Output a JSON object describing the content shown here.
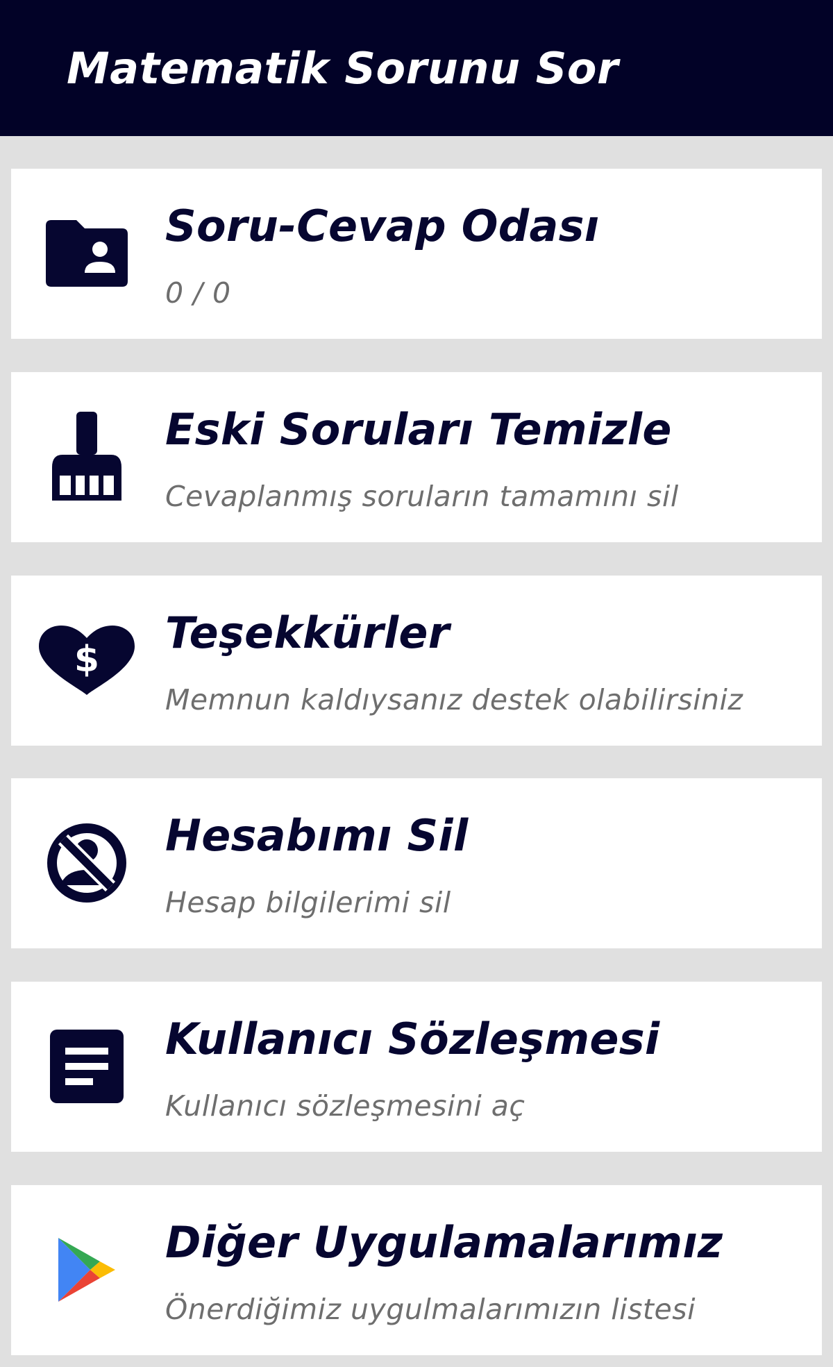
{
  "app_bar": {
    "title": "Matematik Sorunu Sor",
    "background": "#020227"
  },
  "menu": {
    "items": [
      {
        "title": "Soru-Cevap Odası",
        "subtitle": "0 / 0",
        "icon": "folder-shared-icon"
      },
      {
        "title": "Eski Soruları Temizle",
        "subtitle": "Cevaplanmış soruların tamamını sil",
        "icon": "cleaning-brush-icon"
      },
      {
        "title": "Teşekkürler",
        "subtitle": "Memnun kaldıysanız destek olabilirsiniz",
        "icon": "heart-dollar-icon"
      },
      {
        "title": "Hesabımı Sil",
        "subtitle": "Hesap bilgilerimi sil",
        "icon": "no-account-icon"
      },
      {
        "title": "Kullanıcı Sözleşmesi",
        "subtitle": "Kullanıcı sözleşmesini aç",
        "icon": "document-icon"
      },
      {
        "title": "Diğer Uygulamalarımız",
        "subtitle": "Önerdiğimiz uygulmalarımızın listesi",
        "icon": "google-play-icon"
      }
    ]
  },
  "colors": {
    "accent": "#060630",
    "subtitle": "#6e6e6e",
    "card": "#ffffff",
    "background": "#e0e0e0"
  }
}
